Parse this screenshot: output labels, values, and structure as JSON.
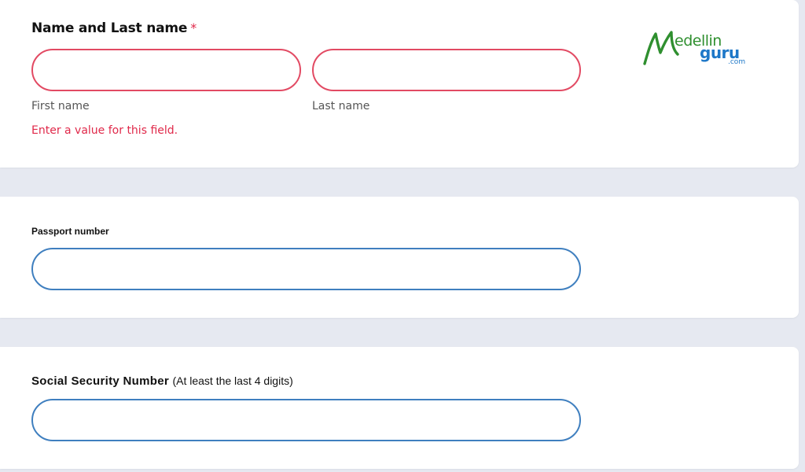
{
  "form": {
    "name_section": {
      "label": "Name and Last name",
      "required_mark": "*",
      "first_name": {
        "value": "",
        "placeholder": "",
        "sublabel": "First name"
      },
      "last_name": {
        "value": "",
        "placeholder": "",
        "sublabel": "Last name"
      },
      "error": "Enter a value for this field."
    },
    "passport_section": {
      "label": "Passport number",
      "value": "",
      "placeholder": ""
    },
    "ssn_section": {
      "label": "Social Security Number",
      "hint": "(At least the last 4 digits)",
      "value": "",
      "placeholder": ""
    }
  },
  "logo": {
    "word1": "edellin",
    "word2": "guru",
    "tld": ".com",
    "colors": {
      "green": "#2f8f2f",
      "blue": "#1e78c8"
    }
  },
  "colors": {
    "error": "#e0294a",
    "field_border": "#3f7fbf",
    "background": "#e6e9f1"
  }
}
